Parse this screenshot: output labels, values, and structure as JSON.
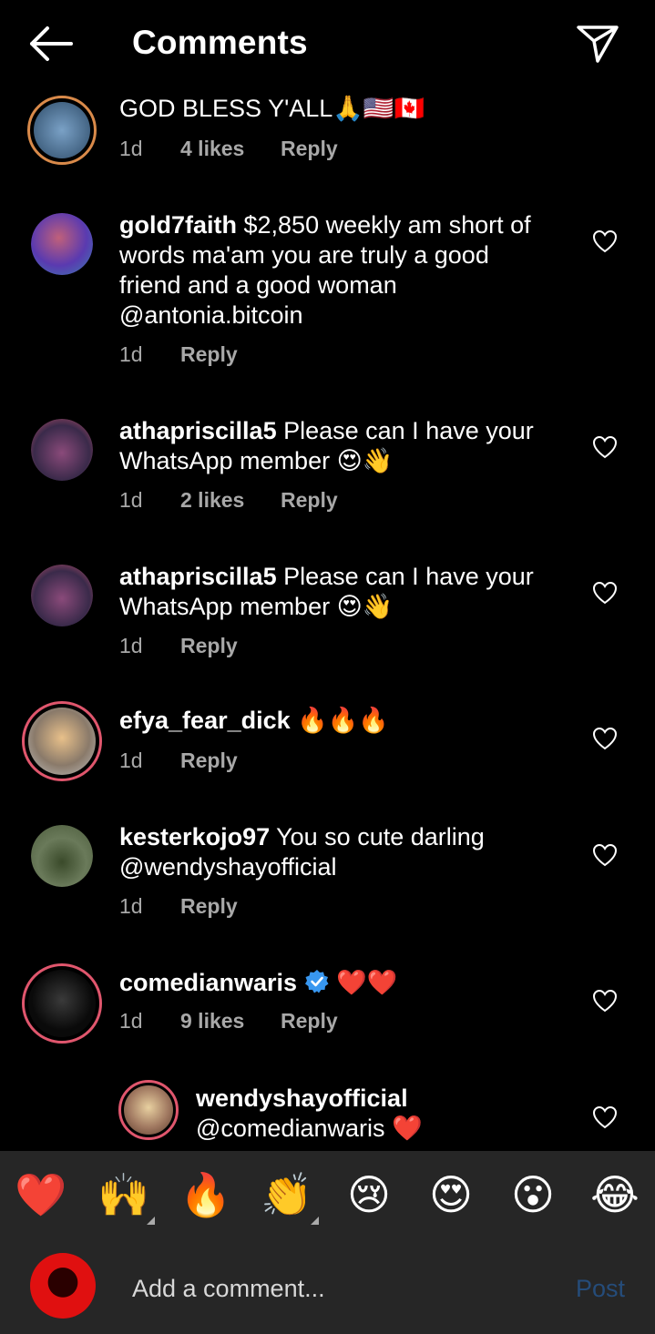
{
  "header": {
    "title": "Comments"
  },
  "comments": [
    {
      "text": "GOD BLESS Y'ALL",
      "emoji": "🙏🇺🇸🇨🇦",
      "time": "1d",
      "likes": "4 likes",
      "reply": "Reply"
    },
    {
      "username": "gold7faith",
      "text": " $2,850 weekly am short of words ma'am you are truly a good friend and a good woman @antonia.bitcoin",
      "time": "1d",
      "reply": "Reply"
    },
    {
      "username": "athapriscilla5",
      "text": " Please can I have your WhatsApp member ",
      "emoji": "😍👋",
      "time": "1d",
      "likes": "2 likes",
      "reply": "Reply"
    },
    {
      "username": "athapriscilla5",
      "text": " Please can I have your WhatsApp member ",
      "emoji": "😍👋",
      "time": "1d",
      "reply": "Reply"
    },
    {
      "username": "efya_fear_dick",
      "text": " ",
      "emoji": "🔥🔥🔥",
      "time": "1d",
      "reply": "Reply"
    },
    {
      "username": "kesterkojo97",
      "text": " You so cute darling @wendyshayofficial",
      "time": "1d",
      "reply": "Reply"
    },
    {
      "username": "comedianwaris",
      "emoji": "❤️❤️",
      "time": "1d",
      "likes": "9 likes",
      "reply": "Reply"
    },
    {
      "username": "wendyshayofficial",
      "text": "@comedianwaris ",
      "emoji": "❤️"
    }
  ],
  "reactions": [
    "❤️",
    "🙌",
    "🔥",
    "👏",
    "😢",
    "😍",
    "😮",
    "😂"
  ],
  "composer": {
    "placeholder": "Add a comment...",
    "post_label": "Post"
  },
  "colors": {
    "background": "#000000",
    "bar": "#262626",
    "meta_text": "#a8a8a8",
    "post_disabled": "#254c7a",
    "story_ring": "#e0566d",
    "verified": "#3897f0"
  }
}
